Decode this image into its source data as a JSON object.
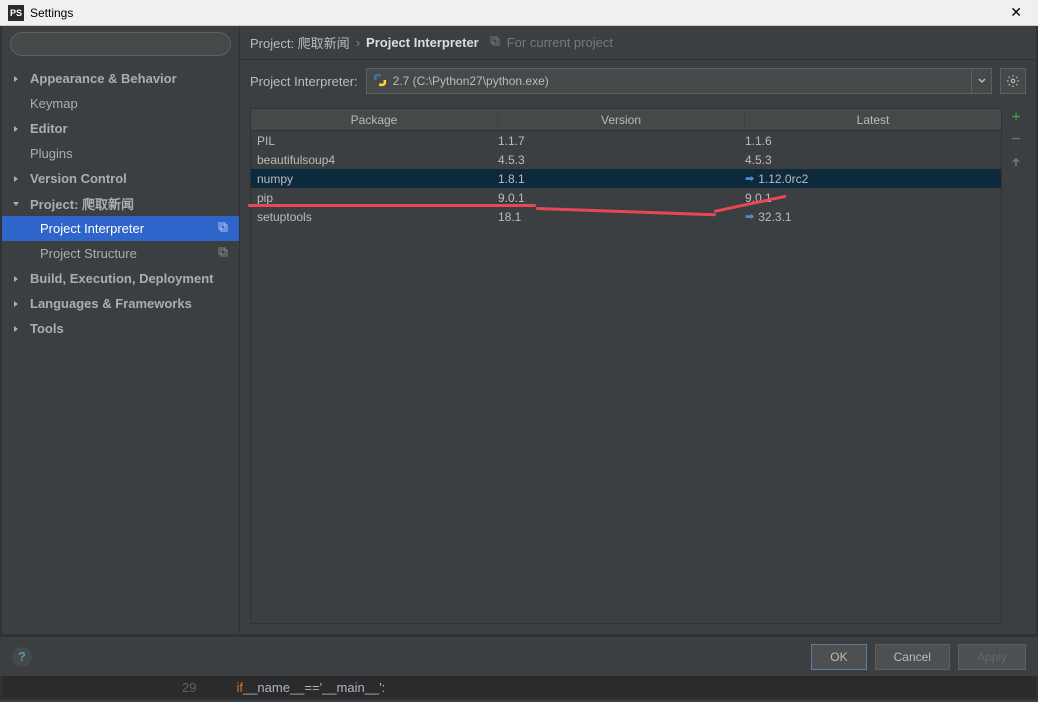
{
  "window": {
    "title": "Settings",
    "app_icon_text": "PS"
  },
  "search": {
    "placeholder": ""
  },
  "sidebar": {
    "items": [
      {
        "label": "Appearance & Behavior",
        "arrow": "right",
        "bold": true
      },
      {
        "label": "Keymap",
        "arrow": "",
        "bold": false
      },
      {
        "label": "Editor",
        "arrow": "right",
        "bold": true
      },
      {
        "label": "Plugins",
        "arrow": "",
        "bold": false
      },
      {
        "label": "Version Control",
        "arrow": "right",
        "bold": true
      },
      {
        "label": "Project: 爬取新闻",
        "arrow": "down",
        "bold": true
      },
      {
        "label": "Project Interpreter",
        "child": true,
        "selected": true,
        "copy": true
      },
      {
        "label": "Project Structure",
        "child": true,
        "copy": true
      },
      {
        "label": "Build, Execution, Deployment",
        "arrow": "right",
        "bold": true
      },
      {
        "label": "Languages & Frameworks",
        "arrow": "right",
        "bold": true
      },
      {
        "label": "Tools",
        "arrow": "right",
        "bold": true
      }
    ]
  },
  "breadcrumb": {
    "part1": "Project: 爬取新闻",
    "sep": "›",
    "part2": "Project Interpreter",
    "hint": "For current project"
  },
  "interpreter": {
    "label": "Project Interpreter:",
    "value": "2.7 (C:\\Python27\\python.exe)"
  },
  "table": {
    "headers": {
      "c1": "Package",
      "c2": "Version",
      "c3": "Latest"
    },
    "rows": [
      {
        "pkg": "PIL",
        "ver": "1.1.7",
        "lat": "1.1.6",
        "upd": false
      },
      {
        "pkg": "beautifulsoup4",
        "ver": "4.5.3",
        "lat": "4.5.3",
        "upd": false
      },
      {
        "pkg": "numpy",
        "ver": "1.8.1",
        "lat": "1.12.0rc2",
        "upd": true,
        "sel": true
      },
      {
        "pkg": "pip",
        "ver": "9.0.1",
        "lat": "9.0.1",
        "upd": false
      },
      {
        "pkg": "setuptools",
        "ver": "18.1",
        "lat": "32.3.1",
        "upd": true
      }
    ]
  },
  "footer": {
    "ok": "OK",
    "cancel": "Cancel",
    "apply": "Apply"
  },
  "code": {
    "line": "29",
    "text_if": "if",
    "text_name": " __name__ ",
    "text_eq": "==",
    "text_main": " '__main__':"
  }
}
